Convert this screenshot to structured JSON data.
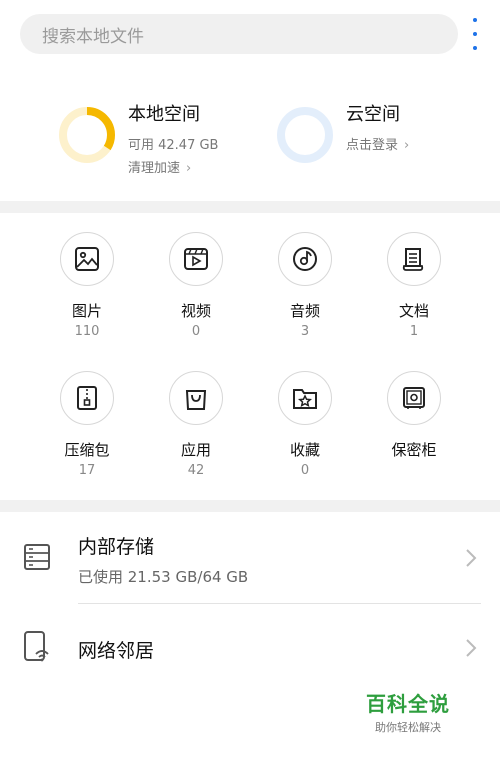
{
  "search": {
    "placeholder": "搜索本地文件"
  },
  "menu": {
    "icon": "more-vertical-icon",
    "color": "#1e73e8"
  },
  "local_space": {
    "title": "本地空间",
    "available": "可用 42.47 GB",
    "action": "清理加速",
    "used_fraction": 0.34,
    "ring_color": "#f5b800",
    "ring_track_color": "#fdf1cc"
  },
  "cloud_space": {
    "title": "云空间",
    "action": "点击登录",
    "ring_color": "#e3eefb"
  },
  "categories": [
    {
      "label": "图片",
      "count": "110",
      "icon": "image-icon"
    },
    {
      "label": "视频",
      "count": "0",
      "icon": "video-icon"
    },
    {
      "label": "音频",
      "count": "3",
      "icon": "audio-icon"
    },
    {
      "label": "文档",
      "count": "1",
      "icon": "document-icon"
    },
    {
      "label": "压缩包",
      "count": "17",
      "icon": "archive-icon"
    },
    {
      "label": "应用",
      "count": "42",
      "icon": "app-bag-icon"
    },
    {
      "label": "收藏",
      "count": "0",
      "icon": "favorites-icon"
    },
    {
      "label": "保密柜",
      "label_only": true,
      "icon": "safe-icon"
    }
  ],
  "internal_storage": {
    "title": "内部存储",
    "usage": "已使用 21.53 GB/64 GB",
    "icon": "storage-icon"
  },
  "network": {
    "title": "网络邻居",
    "icon": "network-device-icon"
  },
  "watermark": {
    "main": "百科全说",
    "sub": "助你轻松解决"
  }
}
